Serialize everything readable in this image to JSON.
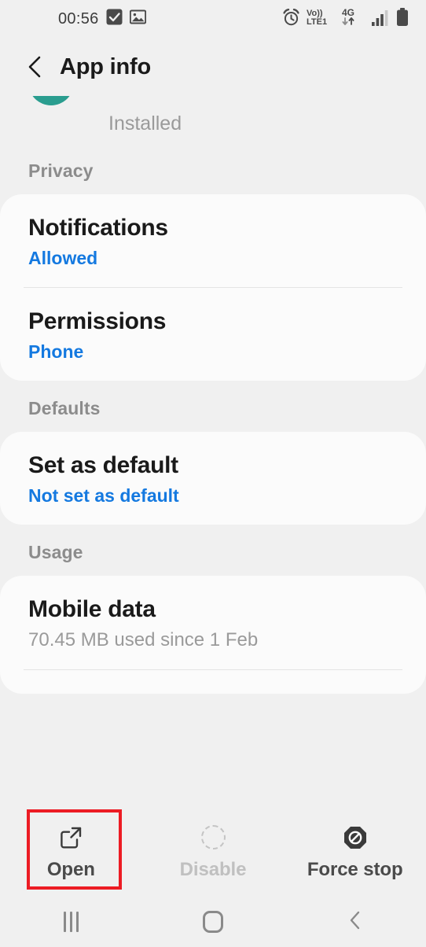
{
  "status_bar": {
    "time": "00:56",
    "left_icons": [
      "checkbox-filled-icon",
      "image-icon"
    ],
    "right_icons": [
      "alarm-icon",
      "volte-lte1-icon",
      "4g-data-icon",
      "signal-bars-icon",
      "battery-full-icon"
    ],
    "volte_line1": "Vo))",
    "volte_line2": "LTE1",
    "network_type": "4G"
  },
  "header": {
    "title": "App info",
    "back_icon": "chevron-left-icon"
  },
  "app_summary": {
    "install_status": "Installed",
    "icon_color": "#2a9d8f"
  },
  "sections": [
    {
      "header": "Privacy",
      "rows": [
        {
          "title": "Notifications",
          "subtitle": "Allowed",
          "subtitle_style": "blue"
        },
        {
          "title": "Permissions",
          "subtitle": "Phone",
          "subtitle_style": "blue"
        }
      ]
    },
    {
      "header": "Defaults",
      "rows": [
        {
          "title": "Set as default",
          "subtitle": "Not set as default",
          "subtitle_style": "blue"
        }
      ]
    },
    {
      "header": "Usage",
      "rows": [
        {
          "title": "Mobile data",
          "subtitle": "70.45 MB used since 1 Feb",
          "subtitle_style": "muted"
        }
      ]
    }
  ],
  "action_bar": {
    "buttons": [
      {
        "label": "Open",
        "icon": "external-link-icon",
        "disabled": false,
        "highlighted": true
      },
      {
        "label": "Disable",
        "icon": "dashed-circle-icon",
        "disabled": true,
        "highlighted": false
      },
      {
        "label": "Force stop",
        "icon": "force-stop-octagon-icon",
        "disabled": false,
        "highlighted": false
      }
    ]
  },
  "nav_bar": {
    "recents": "recents-icon",
    "home": "home-icon",
    "back": "back-icon"
  },
  "colors": {
    "accent_blue": "#1479e0",
    "highlight_red": "#ec1c24",
    "background": "#f0f0f0",
    "card": "#fbfbfb"
  }
}
